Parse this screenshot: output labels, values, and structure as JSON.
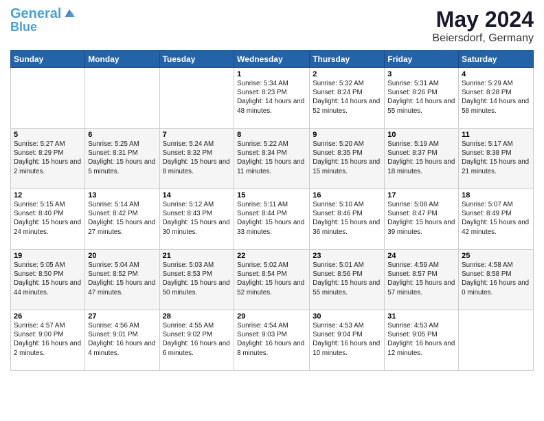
{
  "header": {
    "logo_line1": "General",
    "logo_line2": "Blue",
    "title": "May 2024",
    "subtitle": "Beiersdorf, Germany"
  },
  "weekdays": [
    "Sunday",
    "Monday",
    "Tuesday",
    "Wednesday",
    "Thursday",
    "Friday",
    "Saturday"
  ],
  "weeks": [
    [
      {
        "day": "",
        "info": ""
      },
      {
        "day": "",
        "info": ""
      },
      {
        "day": "",
        "info": ""
      },
      {
        "day": "1",
        "info": "Sunrise: 5:34 AM\nSunset: 8:23 PM\nDaylight: 14 hours\nand 48 minutes."
      },
      {
        "day": "2",
        "info": "Sunrise: 5:32 AM\nSunset: 8:24 PM\nDaylight: 14 hours\nand 52 minutes."
      },
      {
        "day": "3",
        "info": "Sunrise: 5:31 AM\nSunset: 8:26 PM\nDaylight: 14 hours\nand 55 minutes."
      },
      {
        "day": "4",
        "info": "Sunrise: 5:29 AM\nSunset: 8:28 PM\nDaylight: 14 hours\nand 58 minutes."
      }
    ],
    [
      {
        "day": "5",
        "info": "Sunrise: 5:27 AM\nSunset: 8:29 PM\nDaylight: 15 hours\nand 2 minutes."
      },
      {
        "day": "6",
        "info": "Sunrise: 5:25 AM\nSunset: 8:31 PM\nDaylight: 15 hours\nand 5 minutes."
      },
      {
        "day": "7",
        "info": "Sunrise: 5:24 AM\nSunset: 8:32 PM\nDaylight: 15 hours\nand 8 minutes."
      },
      {
        "day": "8",
        "info": "Sunrise: 5:22 AM\nSunset: 8:34 PM\nDaylight: 15 hours\nand 11 minutes."
      },
      {
        "day": "9",
        "info": "Sunrise: 5:20 AM\nSunset: 8:35 PM\nDaylight: 15 hours\nand 15 minutes."
      },
      {
        "day": "10",
        "info": "Sunrise: 5:19 AM\nSunset: 8:37 PM\nDaylight: 15 hours\nand 18 minutes."
      },
      {
        "day": "11",
        "info": "Sunrise: 5:17 AM\nSunset: 8:38 PM\nDaylight: 15 hours\nand 21 minutes."
      }
    ],
    [
      {
        "day": "12",
        "info": "Sunrise: 5:15 AM\nSunset: 8:40 PM\nDaylight: 15 hours\nand 24 minutes."
      },
      {
        "day": "13",
        "info": "Sunrise: 5:14 AM\nSunset: 8:42 PM\nDaylight: 15 hours\nand 27 minutes."
      },
      {
        "day": "14",
        "info": "Sunrise: 5:12 AM\nSunset: 8:43 PM\nDaylight: 15 hours\nand 30 minutes."
      },
      {
        "day": "15",
        "info": "Sunrise: 5:11 AM\nSunset: 8:44 PM\nDaylight: 15 hours\nand 33 minutes."
      },
      {
        "day": "16",
        "info": "Sunrise: 5:10 AM\nSunset: 8:46 PM\nDaylight: 15 hours\nand 36 minutes."
      },
      {
        "day": "17",
        "info": "Sunrise: 5:08 AM\nSunset: 8:47 PM\nDaylight: 15 hours\nand 39 minutes."
      },
      {
        "day": "18",
        "info": "Sunrise: 5:07 AM\nSunset: 8:49 PM\nDaylight: 15 hours\nand 42 minutes."
      }
    ],
    [
      {
        "day": "19",
        "info": "Sunrise: 5:05 AM\nSunset: 8:50 PM\nDaylight: 15 hours\nand 44 minutes."
      },
      {
        "day": "20",
        "info": "Sunrise: 5:04 AM\nSunset: 8:52 PM\nDaylight: 15 hours\nand 47 minutes."
      },
      {
        "day": "21",
        "info": "Sunrise: 5:03 AM\nSunset: 8:53 PM\nDaylight: 15 hours\nand 50 minutes."
      },
      {
        "day": "22",
        "info": "Sunrise: 5:02 AM\nSunset: 8:54 PM\nDaylight: 15 hours\nand 52 minutes."
      },
      {
        "day": "23",
        "info": "Sunrise: 5:01 AM\nSunset: 8:56 PM\nDaylight: 15 hours\nand 55 minutes."
      },
      {
        "day": "24",
        "info": "Sunrise: 4:59 AM\nSunset: 8:57 PM\nDaylight: 15 hours\nand 57 minutes."
      },
      {
        "day": "25",
        "info": "Sunrise: 4:58 AM\nSunset: 8:58 PM\nDaylight: 16 hours\nand 0 minutes."
      }
    ],
    [
      {
        "day": "26",
        "info": "Sunrise: 4:57 AM\nSunset: 9:00 PM\nDaylight: 16 hours\nand 2 minutes."
      },
      {
        "day": "27",
        "info": "Sunrise: 4:56 AM\nSunset: 9:01 PM\nDaylight: 16 hours\nand 4 minutes."
      },
      {
        "day": "28",
        "info": "Sunrise: 4:55 AM\nSunset: 9:02 PM\nDaylight: 16 hours\nand 6 minutes."
      },
      {
        "day": "29",
        "info": "Sunrise: 4:54 AM\nSunset: 9:03 PM\nDaylight: 16 hours\nand 8 minutes."
      },
      {
        "day": "30",
        "info": "Sunrise: 4:53 AM\nSunset: 9:04 PM\nDaylight: 16 hours\nand 10 minutes."
      },
      {
        "day": "31",
        "info": "Sunrise: 4:53 AM\nSunset: 9:05 PM\nDaylight: 16 hours\nand 12 minutes."
      },
      {
        "day": "",
        "info": ""
      }
    ]
  ]
}
